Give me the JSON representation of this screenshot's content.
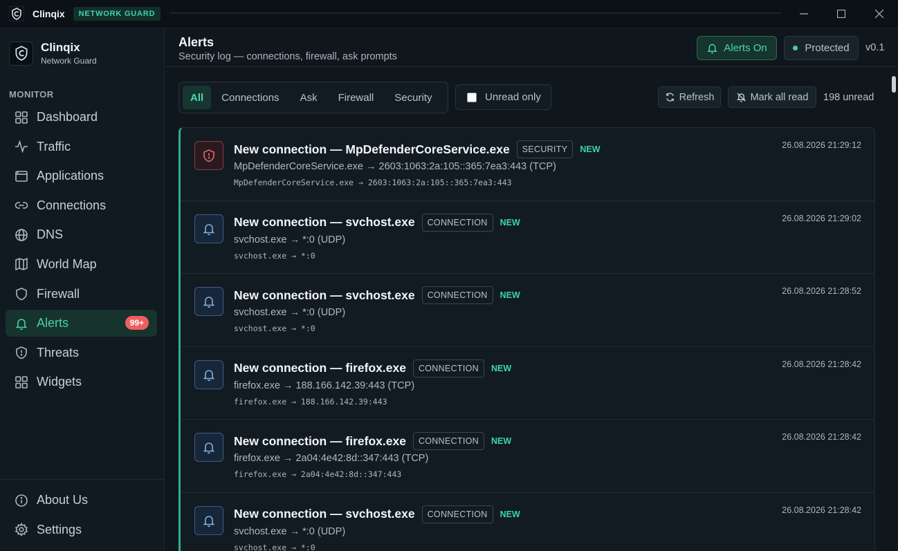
{
  "app": {
    "name": "Clinqix",
    "badge": "NETWORK GUARD",
    "subtitle": "Network Guard"
  },
  "sidebar": {
    "section_label": "MONITOR",
    "items": [
      {
        "label": "Dashboard",
        "icon": "dashboard-icon"
      },
      {
        "label": "Traffic",
        "icon": "activity-icon"
      },
      {
        "label": "Applications",
        "icon": "window-icon"
      },
      {
        "label": "Connections",
        "icon": "link-icon"
      },
      {
        "label": "DNS",
        "icon": "globe-icon"
      },
      {
        "label": "World Map",
        "icon": "map-icon"
      },
      {
        "label": "Firewall",
        "icon": "shield-icon"
      },
      {
        "label": "Alerts",
        "icon": "bell-icon",
        "active": true,
        "badge": "99+"
      },
      {
        "label": "Threats",
        "icon": "shield-alert-icon"
      },
      {
        "label": "Widgets",
        "icon": "grid-icon"
      }
    ],
    "footer": [
      {
        "label": "About Us",
        "icon": "info-icon"
      },
      {
        "label": "Settings",
        "icon": "gear-icon"
      }
    ]
  },
  "header": {
    "title": "Alerts",
    "subtitle": "Security log — connections, firewall, ask prompts",
    "alerts_button": "Alerts On",
    "status": "Protected",
    "version": "v0.1"
  },
  "filters": {
    "tabs": [
      "All",
      "Connections",
      "Ask",
      "Firewall",
      "Security"
    ],
    "active": "All",
    "unread_only": "Unread only",
    "refresh": "Refresh",
    "mark_all_read": "Mark all read",
    "unread_count": "198 unread"
  },
  "alerts": [
    {
      "title": "New connection — MpDefenderCoreService.exe",
      "tag": "SECURITY",
      "new": "NEW",
      "detail": "MpDefenderCoreService.exe → 2603:1063:2a:105::365:7ea3:443 (TCP)",
      "mono": "MpDefenderCoreService.exe → 2603:1063:2a:105::365:7ea3:443",
      "time": "26.08.2026 21:29:12",
      "kind": "security"
    },
    {
      "title": "New connection — svchost.exe",
      "tag": "CONNECTION",
      "new": "NEW",
      "detail": "svchost.exe → *:0 (UDP)",
      "mono": "svchost.exe → *:0",
      "time": "26.08.2026 21:29:02",
      "kind": "connection"
    },
    {
      "title": "New connection — svchost.exe",
      "tag": "CONNECTION",
      "new": "NEW",
      "detail": "svchost.exe → *:0 (UDP)",
      "mono": "svchost.exe → *:0",
      "time": "26.08.2026 21:28:52",
      "kind": "connection"
    },
    {
      "title": "New connection — firefox.exe",
      "tag": "CONNECTION",
      "new": "NEW",
      "detail": "firefox.exe → 188.166.142.39:443 (TCP)",
      "mono": "firefox.exe → 188.166.142.39:443",
      "time": "26.08.2026 21:28:42",
      "kind": "connection"
    },
    {
      "title": "New connection — firefox.exe",
      "tag": "CONNECTION",
      "new": "NEW",
      "detail": "firefox.exe → 2a04:4e42:8d::347:443 (TCP)",
      "mono": "firefox.exe → 2a04:4e42:8d::347:443",
      "time": "26.08.2026 21:28:42",
      "kind": "connection"
    },
    {
      "title": "New connection — svchost.exe",
      "tag": "CONNECTION",
      "new": "NEW",
      "detail": "svchost.exe → *:0 (UDP)",
      "mono": "svchost.exe → *:0",
      "time": "26.08.2026 21:28:42",
      "kind": "connection"
    }
  ],
  "colors": {
    "accent": "#3fd3ac",
    "danger": "#ef5f5f",
    "background": "#0f161c"
  }
}
